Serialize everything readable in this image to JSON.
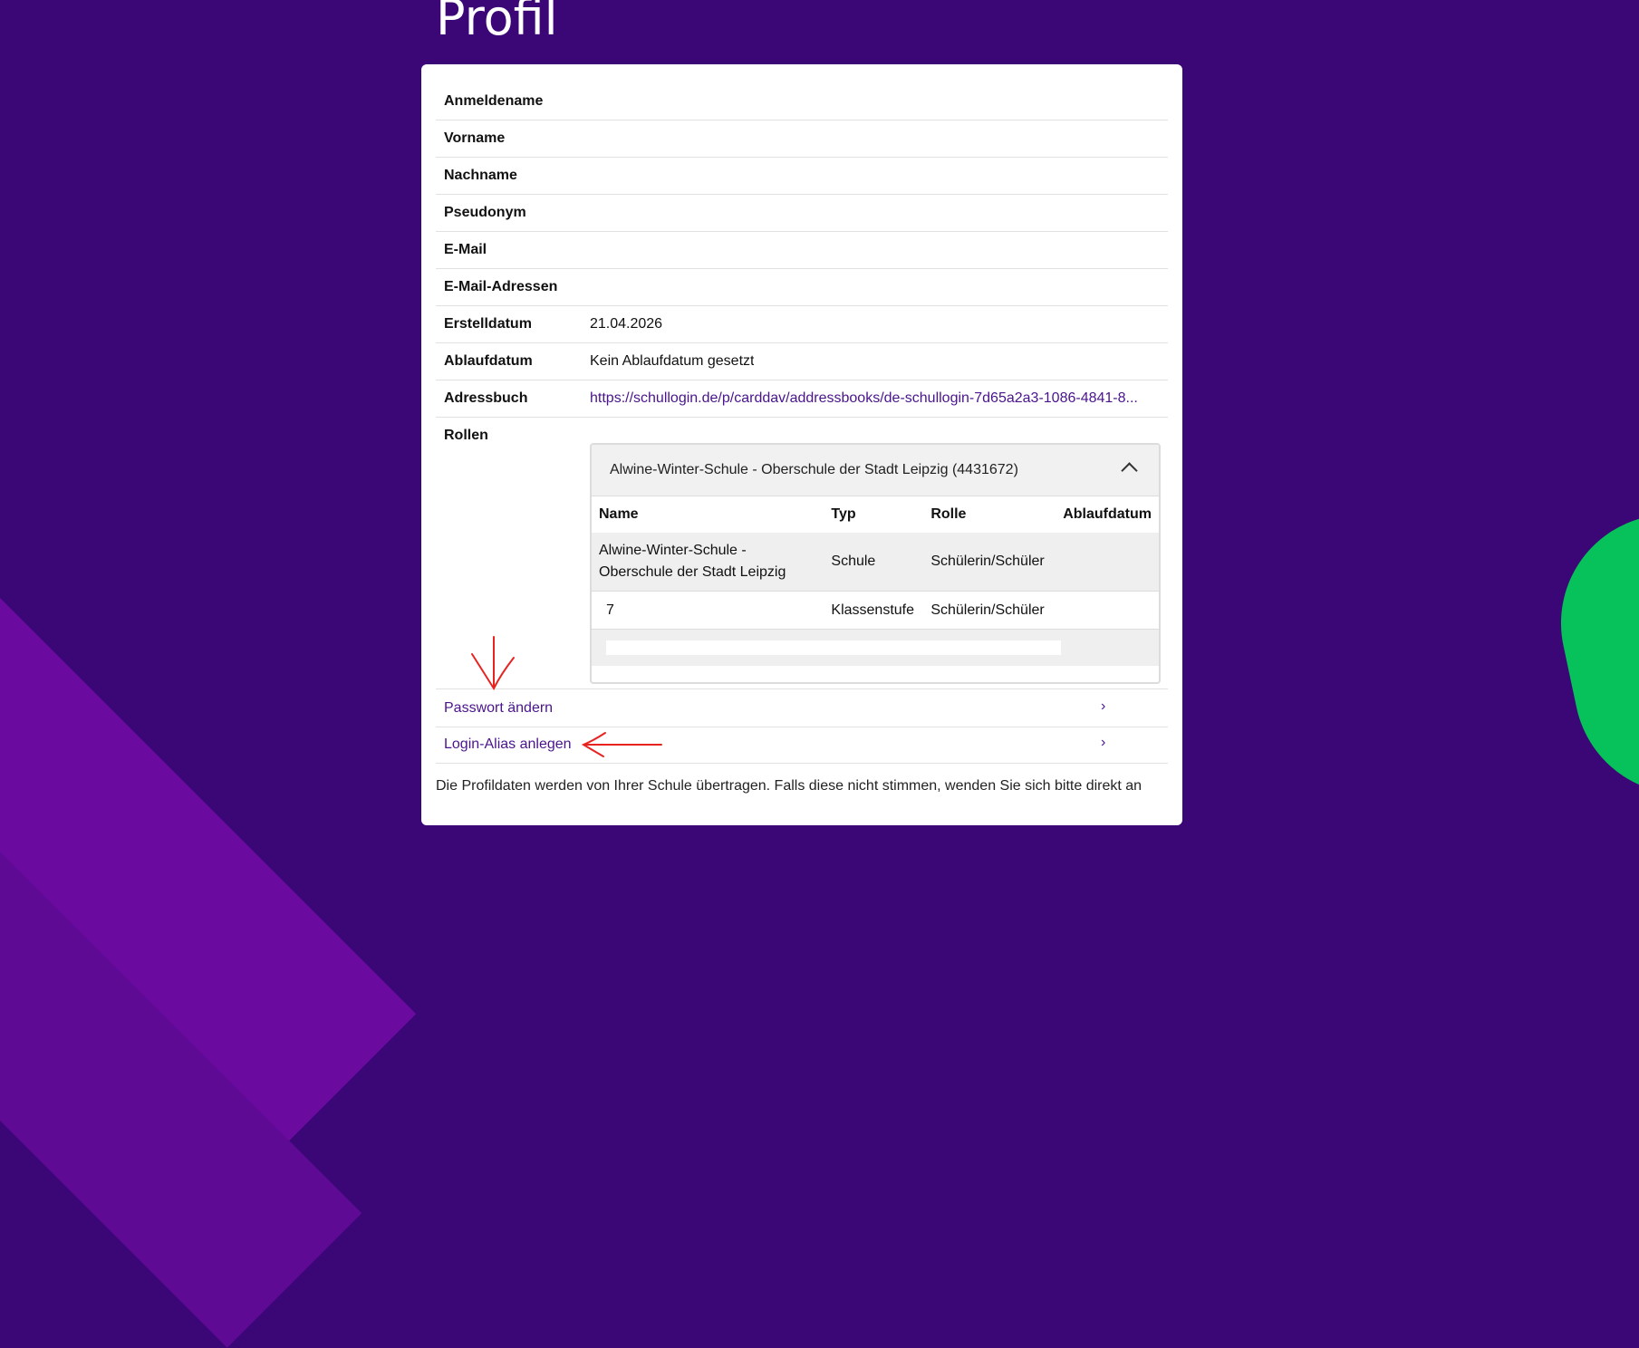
{
  "page": {
    "title": "Profil"
  },
  "profile_fields": [
    {
      "label": "Anmeldename",
      "value": ""
    },
    {
      "label": "Vorname",
      "value": ""
    },
    {
      "label": "Nachname",
      "value": ""
    },
    {
      "label": "Pseudonym",
      "value": ""
    },
    {
      "label": "E-Mail",
      "value": ""
    },
    {
      "label": "E-Mail-Adressen",
      "value": ""
    },
    {
      "label": "Erstelldatum",
      "value": "21.04.2026"
    },
    {
      "label": "Ablaufdatum",
      "value": "Kein Ablaufdatum gesetzt"
    },
    {
      "label": "Adressbuch",
      "value": "https://schullogin.de/p/carddav/addressbooks/de-schullogin-7d65a2a3-1086-4841-8..."
    }
  ],
  "roles": {
    "label": "Rollen",
    "school_panel_title": "Alwine-Winter-Schule - Oberschule der Stadt Leipzig (4431672)",
    "columns": [
      "Name",
      "Typ",
      "Rolle",
      "Ablaufdatum"
    ],
    "rows": [
      [
        "Alwine-Winter-Schule - Oberschule der Stadt Leipzig",
        "Schule",
        "Schülerin/Schüler",
        ""
      ],
      [
        "7",
        "Klassenstufe",
        "Schülerin/Schüler",
        ""
      ]
    ]
  },
  "actions": {
    "change_password": "Passwort ändern",
    "create_login_alias": "Login-Alias anlegen",
    "chevron": "›"
  },
  "notice": "Die Profildaten werden von Ihrer Schule übertragen. Falls diese nicht stimmen, wenden Sie sich bitte direkt an",
  "colors": {
    "background": "#3b0676",
    "stripe": "#6a0a9e",
    "accent_green": "#07c15a",
    "link": "#4a148c",
    "annotation_arrow": "#e8231f"
  }
}
